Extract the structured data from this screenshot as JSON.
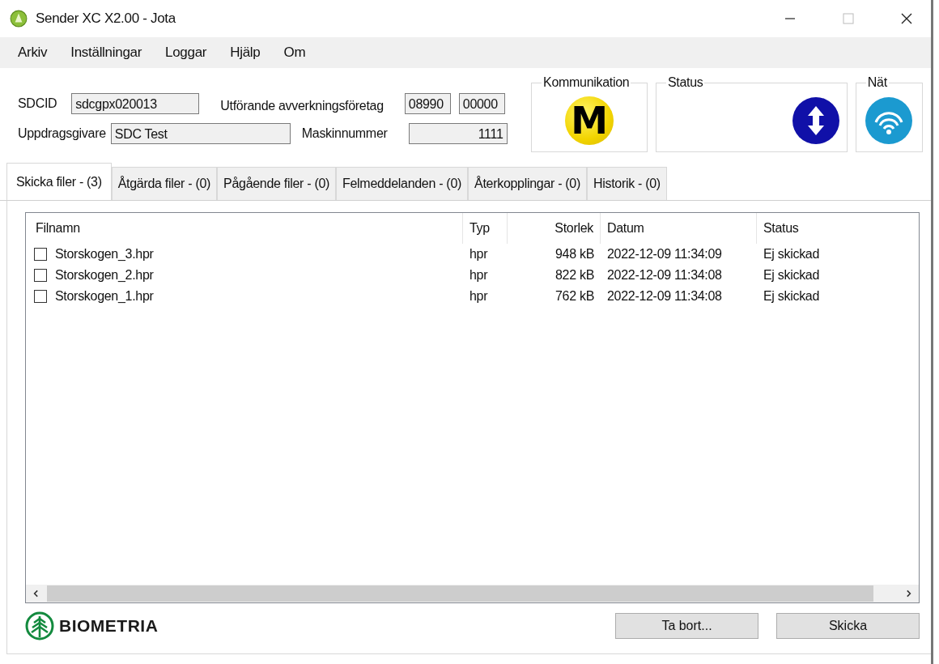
{
  "window": {
    "title": "Sender XC X2.00 - Jota"
  },
  "menu": [
    "Arkiv",
    "Inställningar",
    "Loggar",
    "Hjälp",
    "Om"
  ],
  "fields": {
    "sdcid_label": "SDCID",
    "sdcid": "sdcgpx020013",
    "company_label": "Utförande avverkningsföretag",
    "company_1": "08990",
    "company_2": "00000",
    "client_label": "Uppdragsgivare",
    "client": "SDC Test",
    "machine_label": "Maskinnummer",
    "machine": "1111"
  },
  "groups": {
    "communication": {
      "title": "Kommunikation",
      "letter": "M"
    },
    "status": {
      "title": "Status"
    },
    "network": {
      "title": "Nät"
    }
  },
  "tabs": [
    {
      "label": "Skicka filer - (3)",
      "selected": true
    },
    {
      "label": "Åtgärda filer - (0)",
      "selected": false
    },
    {
      "label": "Pågående filer - (0)",
      "selected": false
    },
    {
      "label": "Felmeddelanden - (0)",
      "selected": false
    },
    {
      "label": "Återkopplingar - (0)",
      "selected": false
    },
    {
      "label": "Historik - (0)",
      "selected": false
    }
  ],
  "table": {
    "columns": [
      "Filnamn",
      "Typ",
      "Storlek",
      "Datum",
      "Status"
    ],
    "rows": [
      {
        "checked": false,
        "cells": [
          "Storskogen_3.hpr",
          "hpr",
          "948 kB",
          "2022-12-09 11:34:09",
          "Ej skickad"
        ]
      },
      {
        "checked": false,
        "cells": [
          "Storskogen_2.hpr",
          "hpr",
          "822 kB",
          "2022-12-09 11:34:08",
          "Ej skickad"
        ]
      },
      {
        "checked": false,
        "cells": [
          "Storskogen_1.hpr",
          "hpr",
          "762 kB",
          "2022-12-09 11:34:08",
          "Ej skickad"
        ]
      }
    ]
  },
  "logo": "BIOMETRIA",
  "buttons": [
    "Ta bort...",
    "Skicka"
  ]
}
